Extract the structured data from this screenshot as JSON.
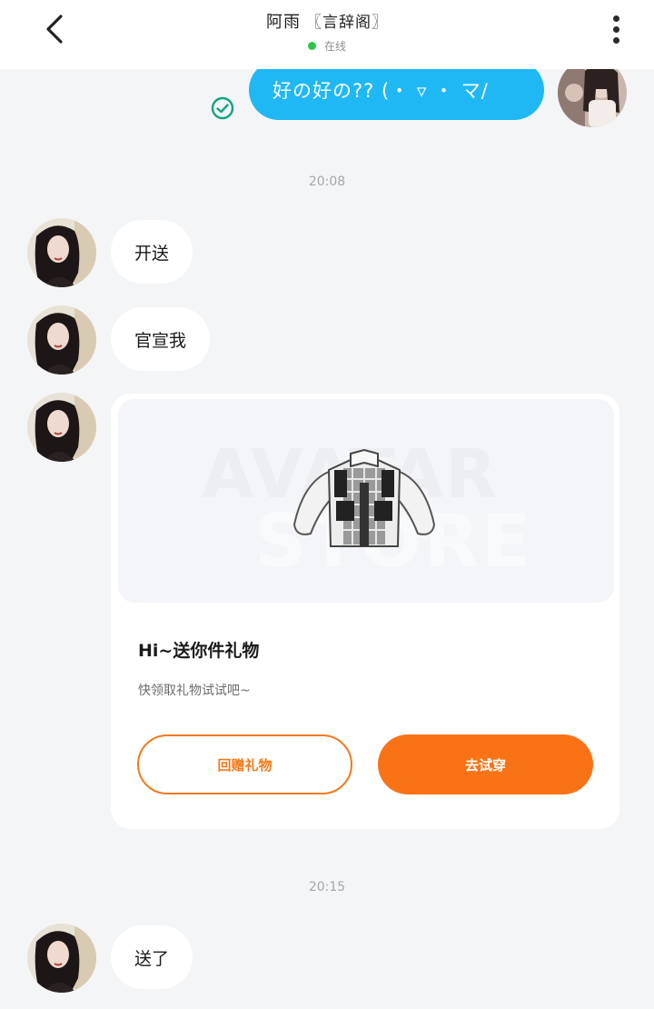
{
  "header": {
    "contact_name": "阿雨",
    "alliance_tag": "〖言辞阁〗",
    "status_text": "在线",
    "status_color": "#2fc350"
  },
  "icons": {
    "back": "chevron-left-icon",
    "more": "more-vertical-icon",
    "read": "check-circle-icon"
  },
  "messages": {
    "sent_1": "好の好の?? (・ ▿ ・ マ/",
    "time_1": "20:08",
    "in_1": "开送",
    "in_2": "官宣我",
    "time_2": "20:15",
    "in_3": "送了"
  },
  "gift_card": {
    "watermark_line1": "AVATAR",
    "watermark_line2": "STORE",
    "title": "Hi~送你件礼物",
    "subtitle": "快领取礼物试试吧~",
    "return_gift_label": "回赠礼物",
    "try_on_label": "去试穿",
    "accent_color": "#f97316"
  },
  "colors": {
    "sent_bubble": "#1fb8f5",
    "background": "#f4f5f7"
  }
}
